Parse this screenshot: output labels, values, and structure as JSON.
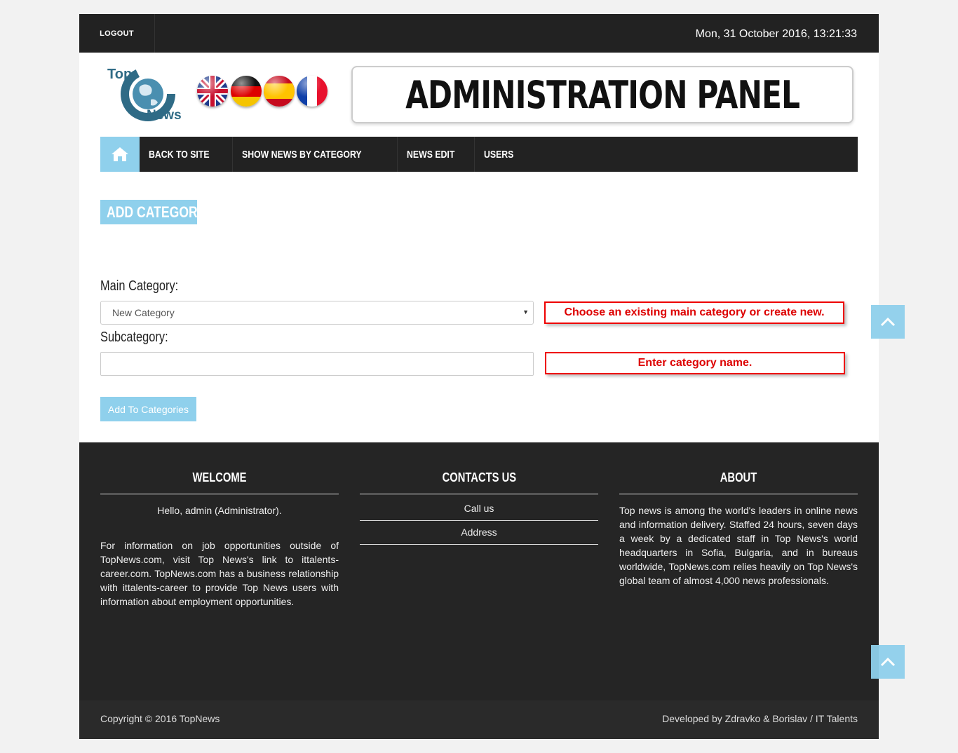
{
  "topbar": {
    "logout_label": "LOGOUT",
    "datetime": "Mon, 31 October 2016, 13:21:33"
  },
  "logo": {
    "top": "Top",
    "news": "News"
  },
  "banner": {
    "title": "ADMINISTRATION PANEL"
  },
  "nav": {
    "items": [
      {
        "label": "BACK TO SITE"
      },
      {
        "label": "SHOW NEWS BY CATEGORY"
      },
      {
        "label": "NEWS EDIT"
      },
      {
        "label": "USERS"
      }
    ]
  },
  "page": {
    "heading": "ADD CATEGORY"
  },
  "form": {
    "main_label": "Main Category:",
    "main_value": "New Category",
    "main_hint": "Choose an existing main category or create new.",
    "sub_label": "Subcategory:",
    "sub_value": "",
    "sub_hint": "Enter category name.",
    "submit_label": "Add To Categories"
  },
  "footer": {
    "welcome": {
      "title": "WELCOME",
      "greeting": "Hello, admin (Administrator).",
      "text": "For information on job opportunities outside of TopNews.com, visit Top News's link to ittalents-career.com. TopNews.com has a business relationship with ittalents-career to provide Top News users with information about employment opportunities."
    },
    "contacts": {
      "title": "CONTACTS US",
      "items": [
        "Call us",
        "Address"
      ]
    },
    "about": {
      "title": "ABOUT",
      "text": "Top news is among the world's leaders in online news and information delivery. Staffed 24 hours, seven days a week by a dedicated staff in Top News's world headquarters in Sofia, Bulgaria, and in bureaus worldwide, TopNews.com relies heavily on Top News's global team of almost 4,000 news professionals."
    },
    "copyright": "Copyright © 2016 TopNews",
    "developed": "Developed by Zdravko & Borislav / IT Talents"
  },
  "colors": {
    "accent": "#8fd0ec",
    "dark": "#222222",
    "hint_red": "#dd0000"
  },
  "icons": {
    "home": "home-icon",
    "scroll_top": "chevron-up-icon"
  }
}
